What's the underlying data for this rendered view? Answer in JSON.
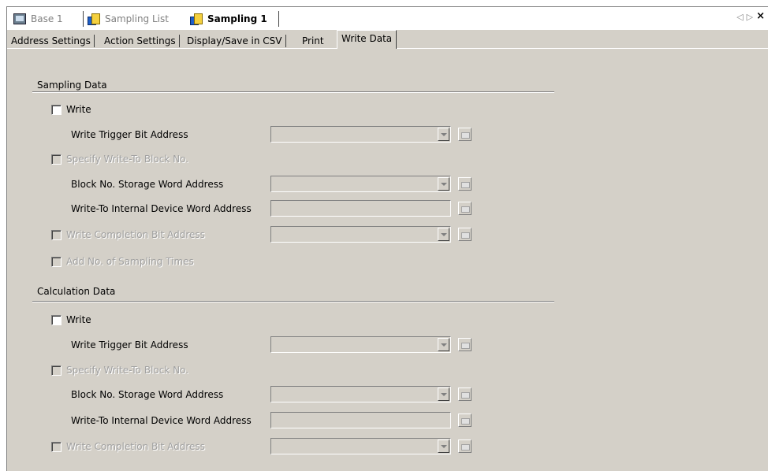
{
  "doc_tabs": [
    {
      "label": "Base 1",
      "icon": "base-screen-icon"
    },
    {
      "label": "Sampling List",
      "icon": "sampling-icon"
    },
    {
      "label": "Sampling 1",
      "icon": "sampling-icon"
    }
  ],
  "nav": {
    "prev": "◁",
    "next": "▷",
    "close": "×"
  },
  "settings_tabs": [
    "Address Settings",
    "Action Settings",
    "Display/Save in CSV",
    "Print",
    "Write Data"
  ],
  "active_settings_tab": "Write Data",
  "sampling": {
    "title": "Sampling Data",
    "write": "Write",
    "trigger": "Write Trigger Bit Address",
    "specify_block": "Specify Write-To Block No.",
    "block_storage": "Block No. Storage Word Address",
    "internal_device": "Write-To Internal Device Word Address",
    "completion": "Write Completion Bit Address",
    "add_times": "Add No. of Sampling Times"
  },
  "calculation": {
    "title": "Calculation Data",
    "write": "Write",
    "trigger": "Write Trigger Bit Address",
    "specify_block": "Specify Write-To Block No.",
    "block_storage": "Block No. Storage Word Address",
    "internal_device": "Write-To Internal Device Word Address",
    "completion": "Write Completion Bit Address"
  }
}
